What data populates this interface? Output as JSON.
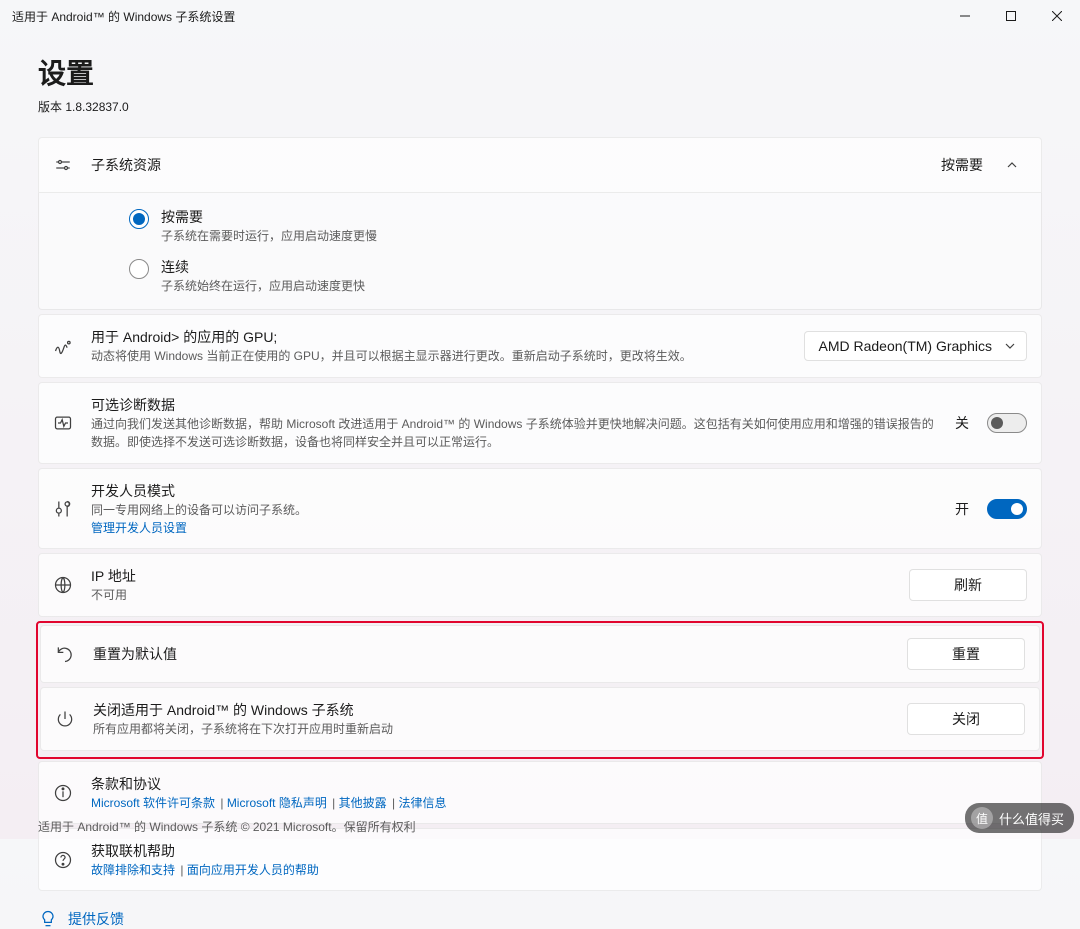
{
  "window": {
    "title": "适用于 Android™ 的 Windows 子系统设置"
  },
  "page": {
    "title": "设置",
    "version": "版本 1.8.32837.0"
  },
  "resources": {
    "title": "子系统资源",
    "value": "按需要",
    "options": [
      {
        "label": "按需要",
        "desc": "子系统在需要时运行，应用启动速度更慢",
        "checked": true
      },
      {
        "label": "连续",
        "desc": "子系统始终在运行，应用启动速度更快",
        "checked": false
      }
    ]
  },
  "gpu": {
    "title": "用于 Android> 的应用的 GPU;",
    "desc": "动态将使用 Windows 当前正在使用的 GPU，并且可以根据主显示器进行更改。重新启动子系统时，更改将生效。",
    "select_label": "AMD Radeon(TM) Graphics"
  },
  "diag": {
    "title": "可选诊断数据",
    "desc": "通过向我们发送其他诊断数据，帮助 Microsoft 改进适用于 Android™ 的 Windows 子系统体验并更快地解决问题。这包括有关如何使用应用和增强的错误报告的数据。即使选择不发送可选诊断数据，设备也将同样安全并且可以正常运行。",
    "state": "关"
  },
  "dev": {
    "title": "开发人员模式",
    "desc": "同一专用网络上的设备可以访问子系统。",
    "link": "管理开发人员设置",
    "state": "开"
  },
  "ip": {
    "title": "IP 地址",
    "desc": "不可用",
    "button": "刷新"
  },
  "reset": {
    "title": "重置为默认值",
    "button": "重置"
  },
  "shutdown": {
    "title": "关闭适用于 Android™ 的 Windows 子系统",
    "desc": "所有应用都将关闭，子系统将在下次打开应用时重新启动",
    "button": "关闭"
  },
  "terms": {
    "title": "条款和协议",
    "links": [
      "Microsoft 软件许可条款",
      "Microsoft 隐私声明",
      "其他披露",
      "法律信息"
    ],
    "sep": " | "
  },
  "help": {
    "title": "获取联机帮助",
    "links": [
      "故障排除和支持",
      "面向应用开发人员的帮助"
    ],
    "sep": " | "
  },
  "feedback": {
    "label": "提供反馈"
  },
  "footer": {
    "text": "适用于 Android™ 的 Windows 子系统 © 2021 Microsoft。保留所有权利"
  },
  "watermark": {
    "text": "什么值得买",
    "badge": "值"
  }
}
